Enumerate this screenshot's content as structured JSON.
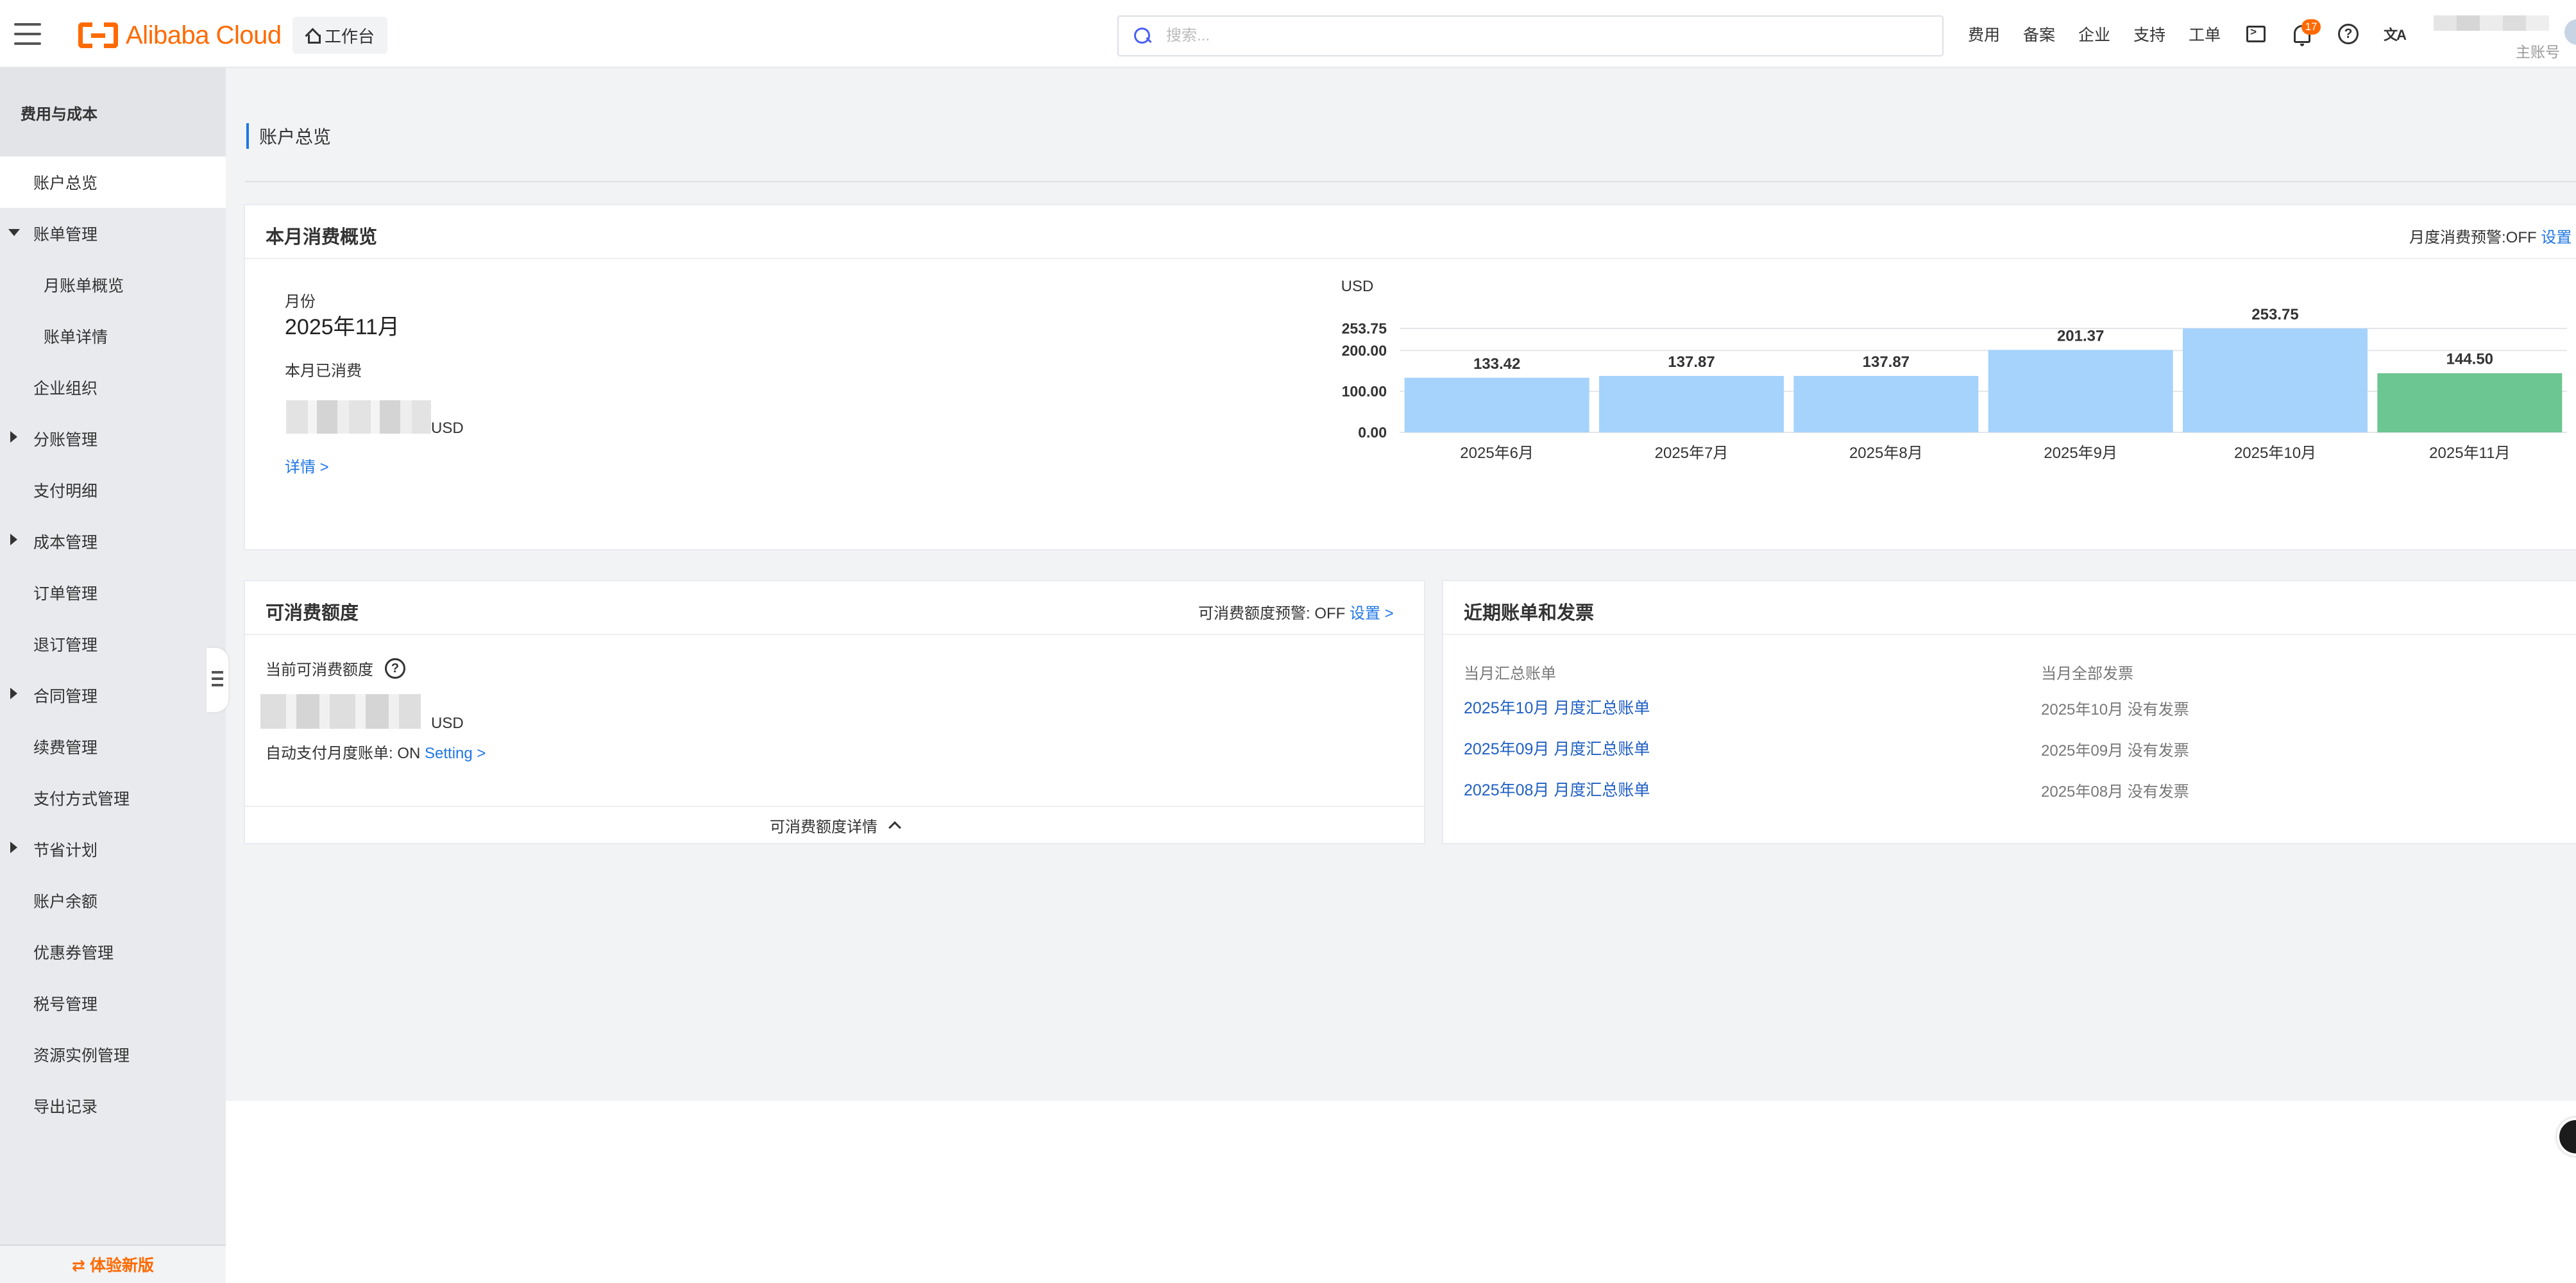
{
  "header": {
    "logo_text": "Alibaba Cloud",
    "workbench_label": "工作台",
    "search_placeholder": "搜索...",
    "nav": [
      "费用",
      "备案",
      "企业",
      "支持",
      "工单"
    ],
    "notification_count": "17",
    "help_glyph": "?",
    "lang_glyph": "文A",
    "account_label": "主账号"
  },
  "sidebar": {
    "title": "费用与成本",
    "items": [
      {
        "label": "账户总览",
        "active": true
      },
      {
        "label": "账单管理",
        "expanded": true
      },
      {
        "label": "月账单概览",
        "sub": true
      },
      {
        "label": "账单详情",
        "sub": true
      },
      {
        "label": "企业组织"
      },
      {
        "label": "分账管理",
        "collapsed": true
      },
      {
        "label": "支付明细"
      },
      {
        "label": "成本管理",
        "collapsed": true
      },
      {
        "label": "订单管理"
      },
      {
        "label": "退订管理"
      },
      {
        "label": "合同管理",
        "collapsed": true
      },
      {
        "label": "续费管理"
      },
      {
        "label": "支付方式管理"
      },
      {
        "label": "节省计划",
        "collapsed": true
      },
      {
        "label": "账户余额"
      },
      {
        "label": "优惠券管理"
      },
      {
        "label": "税号管理"
      },
      {
        "label": "资源实例管理"
      },
      {
        "label": "导出记录"
      }
    ],
    "bottom_label": "⇄ 体验新版"
  },
  "page": {
    "title": "账户总览"
  },
  "overview": {
    "title": "本月消费概览",
    "alert_label": "月度消费预警:OFF",
    "alert_link": "设置 >",
    "month_caption": "月份",
    "month_value": "2025年11月",
    "spent_caption": "本月已消费",
    "spent_unit": "USD",
    "detail_link": "详情 >"
  },
  "chart_data": {
    "type": "bar",
    "title": "",
    "ylabel": "USD",
    "categories": [
      "2025年6月",
      "2025年7月",
      "2025年8月",
      "2025年9月",
      "2025年10月",
      "2025年11月"
    ],
    "values": [
      133.42,
      137.87,
      137.87,
      201.37,
      253.75,
      144.5
    ],
    "value_labels": [
      "133.42",
      "137.87",
      "137.87",
      "201.37",
      "253.75",
      "144.50"
    ],
    "ylim": [
      0,
      253.75
    ],
    "yticks": [
      "0.00",
      "100.00",
      "200.00",
      "253.75"
    ],
    "grid": true,
    "colors": {
      "past": "#a5d3fc",
      "current": "#6cc691"
    }
  },
  "balance": {
    "title": "可消费额度",
    "warning_label": "可消费额度预警:",
    "warning_state": "OFF",
    "warning_link": "设置 >",
    "current_caption": "当前可消费额度",
    "unit": "USD",
    "autopay_label": "自动支付月度账单:",
    "autopay_state": "ON",
    "autopay_link": "Setting >",
    "footer_label": "可消费额度详情"
  },
  "recent": {
    "title": "近期账单和发票",
    "col_bills": "当月汇总账单",
    "col_invoices": "当月全部发票",
    "rows": [
      {
        "bill": "2025年10月 月度汇总账单",
        "invoice": "2025年10月 没有发票"
      },
      {
        "bill": "2025年09月 月度汇总账单",
        "invoice": "2025年09月 没有发票"
      },
      {
        "bill": "2025年08月 月度汇总账单",
        "invoice": "2025年08月 没有发票"
      }
    ]
  }
}
